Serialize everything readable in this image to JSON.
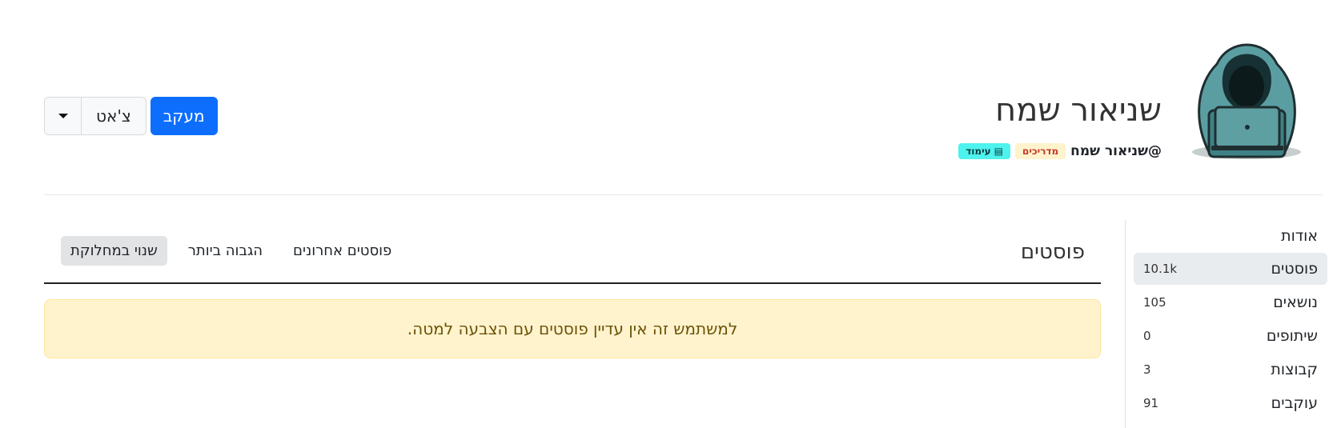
{
  "profile": {
    "display_name": "שניאור שמח",
    "username": "@שניאור שמח",
    "group_badge": "מדריכים",
    "pin_badge": "עימוד",
    "avatar_alt": "hooded-hacker-avatar"
  },
  "actions": {
    "follow_label": "מעקב",
    "chat_label": "צ'אט",
    "more_icon": "caret-down-icon"
  },
  "sidebar": {
    "items": [
      {
        "label": "אודות",
        "count": ""
      },
      {
        "label": "פוסטים",
        "count": "10.1k"
      },
      {
        "label": "נושאים",
        "count": "105"
      },
      {
        "label": "שיתופים",
        "count": "0"
      },
      {
        "label": "קבוצות",
        "count": "3"
      },
      {
        "label": "עוקבים",
        "count": "91"
      }
    ]
  },
  "posts": {
    "title": "פוסטים",
    "tabs": [
      "פוסטים אחרונים",
      "הגבוה ביותר",
      "שנוי במחלוקת"
    ],
    "empty_message": "למשתמש זה אין עדיין פוסטים עם הצבעה למטה."
  },
  "colors": {
    "primary": "#0d6efd",
    "warning_bg": "#fff3cd",
    "pin_badge_bg": "#4ef2ee"
  }
}
